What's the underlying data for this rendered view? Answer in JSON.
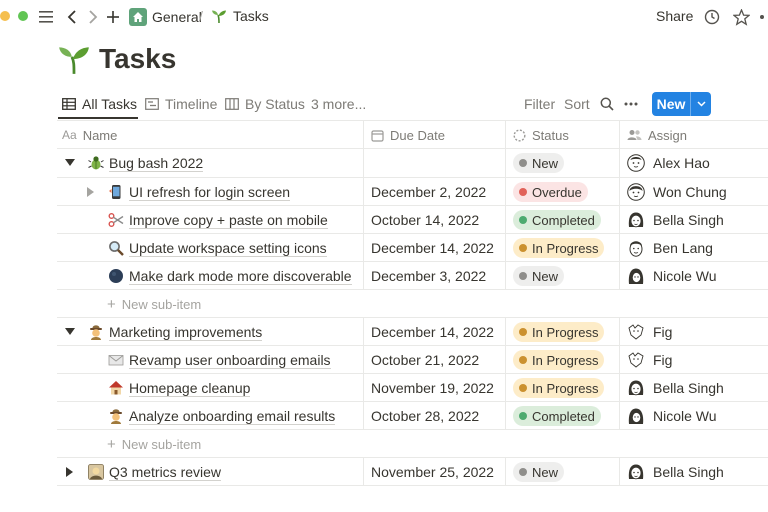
{
  "colors": {
    "accent": "#2383e2",
    "text": "#37352f",
    "muted": "#7d7b76"
  },
  "topbar": {
    "breadcrumb_workspace": "General",
    "breadcrumb_separator": "/",
    "breadcrumb_page": "Tasks",
    "share_label": "Share"
  },
  "page": {
    "title": "Tasks",
    "icon": "seedling-icon"
  },
  "tabs": [
    {
      "label": "All Tasks",
      "icon": "table-icon"
    },
    {
      "label": "Timeline",
      "icon": "timeline-icon"
    },
    {
      "label": "By Status",
      "icon": "board-icon"
    },
    {
      "label": "3 more..."
    }
  ],
  "toolbar": {
    "filter": "Filter",
    "sort": "Sort",
    "new_label": "New"
  },
  "columns": {
    "name": "Name",
    "name_prefix": "Aa",
    "due": "Due Date",
    "status": "Status",
    "assign": "Assign"
  },
  "statuses": {
    "new": {
      "label": "New",
      "bg": "#eeeeed",
      "dot": "#8f8e8b",
      "fg": "#37352f"
    },
    "overdue": {
      "label": "Overdue",
      "bg": "#fbe4e4",
      "dot": "#e16259",
      "fg": "#37352f"
    },
    "completed": {
      "label": "Completed",
      "bg": "#dbeddb",
      "dot": "#4dab6f",
      "fg": "#37352f"
    },
    "progress": {
      "label": "In Progress",
      "bg": "#fdecc8",
      "dot": "#cb912f",
      "fg": "#37352f"
    }
  },
  "rows": [
    {
      "name": "Bug bash 2022",
      "due": "",
      "status": "New",
      "assignee": "Alex Hao",
      "icon": "bug-icon"
    },
    {
      "name": "UI refresh for login screen",
      "due": "December 2, 2022",
      "status": "Overdue",
      "assignee": "Won Chung",
      "icon": "mobile-phone-icon"
    },
    {
      "name": "Improve copy + paste on mobile",
      "due": "October 14, 2022",
      "status": "Completed",
      "assignee": "Bella Singh",
      "icon": "scissors-icon"
    },
    {
      "name": "Update workspace setting icons",
      "due": "December 14, 2022",
      "status": "In Progress",
      "assignee": "Ben Lang",
      "icon": "magnifier-icon"
    },
    {
      "name": "Make dark mode more discoverable",
      "due": "December 3, 2022",
      "status": "New",
      "assignee": "Nicole Wu",
      "icon": "dark-circle-icon"
    },
    {
      "name": "Marketing improvements",
      "due": "December 14, 2022",
      "status": "In Progress",
      "assignee": "Fig",
      "icon": "detective-icon"
    },
    {
      "name": "Revamp user onboarding emails",
      "due": "October 21, 2022",
      "status": "In Progress",
      "assignee": "Fig",
      "icon": "envelope-icon"
    },
    {
      "name": "Homepage cleanup",
      "due": "November 19, 2022",
      "status": "In Progress",
      "assignee": "Bella Singh",
      "icon": "house-icon"
    },
    {
      "name": "Analyze onboarding email results",
      "due": "October 28, 2022",
      "status": "Completed",
      "assignee": "Nicole Wu",
      "icon": "detective-icon"
    },
    {
      "name": "Q3 metrics review",
      "due": "November 25, 2022",
      "status": "New",
      "assignee": "Bella Singh",
      "icon": "chart-photo-icon"
    }
  ],
  "new_subitem_label": "New sub-item"
}
